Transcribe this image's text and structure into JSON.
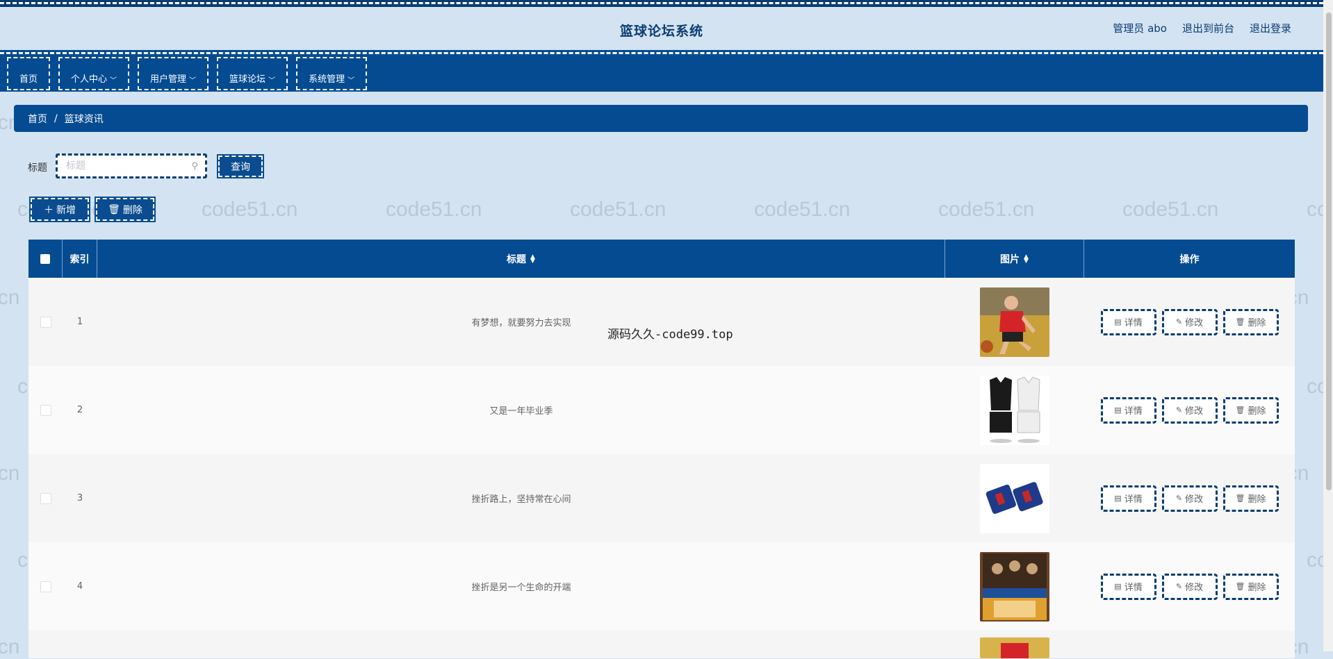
{
  "header": {
    "title": "篮球论坛系统",
    "user": "管理员 abo",
    "front_link": "退出到前台",
    "logout": "退出登录"
  },
  "nav": [
    {
      "label": "首页",
      "has_dropdown": false
    },
    {
      "label": "个人中心",
      "has_dropdown": true
    },
    {
      "label": "用户管理",
      "has_dropdown": true
    },
    {
      "label": "篮球论坛",
      "has_dropdown": true
    },
    {
      "label": "系统管理",
      "has_dropdown": true
    }
  ],
  "breadcrumb": {
    "home": "首页",
    "separator": "/",
    "current": "篮球资讯"
  },
  "search": {
    "label": "标题",
    "placeholder": "标题",
    "button": "查询"
  },
  "actions": {
    "add": "新增",
    "delete": "删除"
  },
  "table": {
    "columns": {
      "index": "索引",
      "title": "标题",
      "image": "图片",
      "ops": "操作"
    },
    "rows": [
      {
        "index": "1",
        "title": "有梦想，就要努力去实现",
        "image": "basketball-player-photo"
      },
      {
        "index": "2",
        "title": "又是一年毕业季",
        "image": "jersey-photo"
      },
      {
        "index": "3",
        "title": "挫折路上，坚持常在心间",
        "image": "wristband-photo"
      },
      {
        "index": "4",
        "title": "挫折是另一个生命的开端",
        "image": "book-cover-photo"
      }
    ],
    "op_labels": {
      "detail": "详情",
      "edit": "修改",
      "delete": "删除"
    }
  },
  "overlay_text": "源码久久-code99.top",
  "watermark": "code51.cn",
  "colors": {
    "primary": "#044b92",
    "dark_border": "#0a3c72",
    "background": "#d3e3f1"
  }
}
